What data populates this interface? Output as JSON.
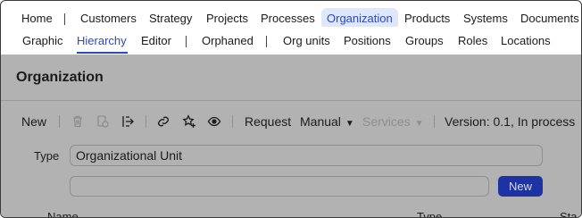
{
  "nav_main": {
    "items": [
      "Home",
      "Customers",
      "Strategy",
      "Projects",
      "Processes",
      "Organization",
      "Products",
      "Systems",
      "Documents"
    ],
    "active": "Organization"
  },
  "nav_sub": {
    "items": [
      "Graphic",
      "Hierarchy",
      "Editor",
      "Orphaned",
      "Org units",
      "Positions",
      "Groups",
      "Roles",
      "Locations"
    ],
    "selected": "Hierarchy"
  },
  "page": {
    "title": "Organization"
  },
  "toolbar": {
    "new_label": "New",
    "request_label": "Request",
    "manual_label": "Manual",
    "services_label": "Services",
    "version_label": "Version: 0.1, In process",
    "icons": [
      "trash-icon",
      "copy-icon",
      "export-icon",
      "link-icon",
      "star-add-icon",
      "eye-icon"
    ]
  },
  "form": {
    "type_label": "Type",
    "type_value": "Organizational Unit",
    "second_value": "",
    "new_button": "New"
  },
  "table": {
    "columns": [
      "Name",
      "Type",
      "Sta"
    ]
  },
  "colors": {
    "accent": "#2a48c5",
    "highlight_bg": "#dfe7fb",
    "button_bg": "#1d33a3",
    "dim": "#b2b2b2"
  }
}
